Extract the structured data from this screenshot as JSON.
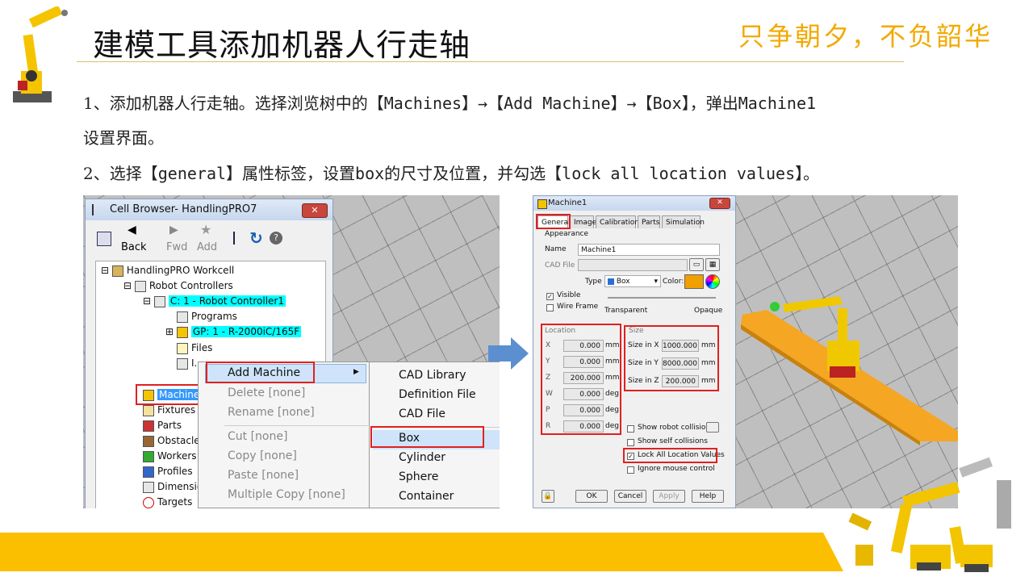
{
  "header": {
    "title": "建模工具添加机器人行走轴",
    "slogan": "只争朝夕，不负韶华"
  },
  "body": {
    "p1_line1_pre": "1、添加机器人行走轴。选择浏览树中的",
    "p1_code": "【Machines】→【Add Machine】→【Box】",
    "p1_mid": "，弹出",
    "p1_code2": "Machine1",
    "p1_line2": "设置界面。",
    "p2_pre": "2、选择",
    "p2_code": "【general】",
    "p2_mid": "属性标签，设置",
    "p2_code2": "box",
    "p2_mid2": "的尺寸及位置，并勾选",
    "p2_code3": "【lock all location values】",
    "p2_end": "。"
  },
  "cell_browser": {
    "title": "Cell Browser- HandlingPRO7",
    "close": "✕",
    "toolbar": {
      "back": "Back",
      "fwd": "Fwd",
      "add": "Add"
    },
    "tree": [
      {
        "label": "HandlingPRO Workcell"
      },
      {
        "label": "Robot Controllers"
      },
      {
        "label": "C: 1 - Robot Controller1"
      },
      {
        "label": "Programs"
      },
      {
        "label": "GP: 1 - R-2000iC/165F"
      },
      {
        "label": "Files"
      },
      {
        "label": "I..."
      },
      {
        "label": "Machines"
      },
      {
        "label": "Fixtures"
      },
      {
        "label": "Parts"
      },
      {
        "label": "Obstacles"
      },
      {
        "label": "Workers"
      },
      {
        "label": "Profiles"
      },
      {
        "label": "Dimensions"
      },
      {
        "label": "Targets"
      }
    ],
    "context_menu": [
      "Add Machine",
      "Delete [none]",
      "Rename [none]",
      "Cut [none]",
      "Copy [none]",
      "Paste [none]",
      "Multiple Copy [none]"
    ],
    "submenu": [
      "CAD Library",
      "Definition File",
      "CAD File",
      "Box",
      "Cylinder",
      "Sphere",
      "Container"
    ],
    "submenu_arrow": "▶"
  },
  "machine_dialog": {
    "title": "Machine1",
    "close": "✕",
    "tabs": [
      "General",
      "Image",
      "Calibration",
      "Parts",
      "Simulation"
    ],
    "appearance": "Appearance",
    "name_label": "Name",
    "name_value": "Machine1",
    "cad_label": "CAD File",
    "type_label": "Type",
    "type_value": "Box",
    "color_label": "Color:",
    "visible": "Visible",
    "wireframe": "Wire Frame",
    "transparent": "Transparent",
    "opaque": "Opaque",
    "location_title": "Location",
    "location": [
      {
        "axis": "X",
        "value": "0.000",
        "unit": "mm"
      },
      {
        "axis": "Y",
        "value": "0.000",
        "unit": "mm"
      },
      {
        "axis": "Z",
        "value": "200.000",
        "unit": "mm"
      },
      {
        "axis": "W",
        "value": "0.000",
        "unit": "deg"
      },
      {
        "axis": "P",
        "value": "0.000",
        "unit": "deg"
      },
      {
        "axis": "R",
        "value": "0.000",
        "unit": "deg"
      }
    ],
    "size_title": "Size",
    "size": [
      {
        "label": "Size in X",
        "value": "1000.000",
        "unit": "mm"
      },
      {
        "label": "Size in Y",
        "value": "8000.000",
        "unit": "mm"
      },
      {
        "label": "Size in Z",
        "value": "200.000",
        "unit": "mm"
      }
    ],
    "show_robot_collisions": "Show robot collisions",
    "show_self_collisions": "Show self collisions",
    "lock_all": "Lock All Location Values",
    "ignore_mouse": "Ignore mouse control",
    "ok": "OK",
    "cancel": "Cancel",
    "apply": "Apply",
    "help": "Help",
    "check_mark": "✓",
    "color_value": "#f0a000"
  },
  "colors": {
    "accent": "#fbbf00",
    "red": "#e02020",
    "arrow": "#5b8fd0"
  }
}
